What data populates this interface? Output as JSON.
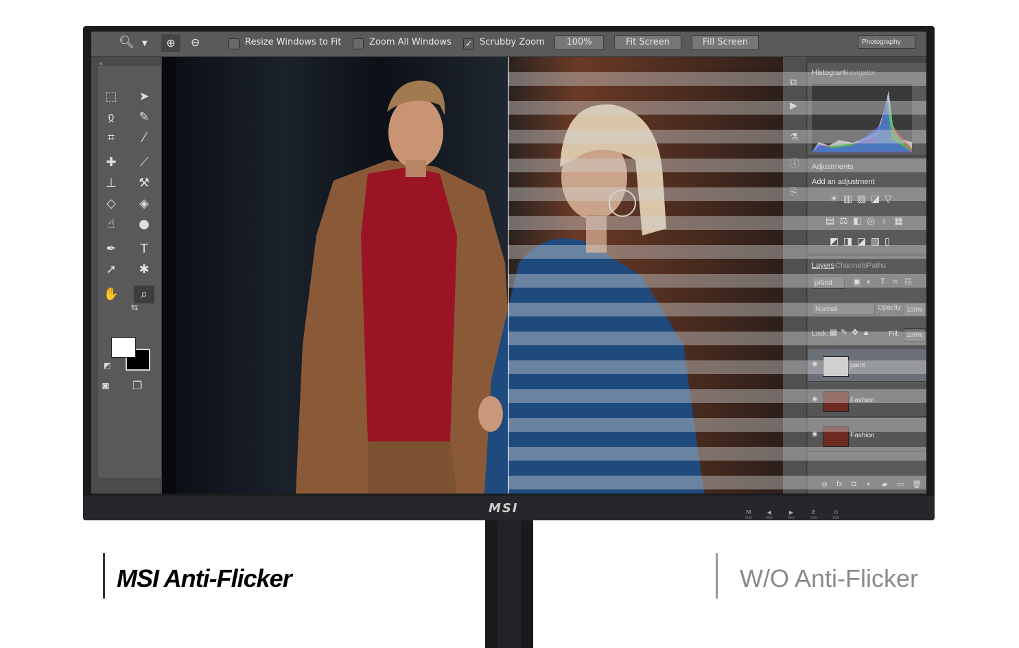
{
  "options_bar": {
    "resize_windows": "Resize Windows to Fit",
    "zoom_all": "Zoom All Windows",
    "scrubby_zoom": "Scrubby Zoom",
    "zoom_level": "100%",
    "fit_screen": "Fit Screen",
    "fill_screen": "Fill Screen",
    "workspace": "Photography"
  },
  "panels": {
    "histogram_tab": "Histogram",
    "navigator_tab": "Navigator",
    "adjustments_title": "Adjustments",
    "add_adjustment": "Add an adjustment",
    "layers_tab": "Layers",
    "channels_tab": "Channels",
    "paths_tab": "Paths",
    "kind": "ρKind",
    "blend_mode": "Normal",
    "opacity_label": "Opacity:",
    "opacity_value": "100%",
    "lock_label": "Lock:",
    "fill_label": "Fill:",
    "fill_value": "100%",
    "layers": [
      {
        "name": "paint",
        "active": true
      },
      {
        "name": "Fashion",
        "active": false
      },
      {
        "name": "Fashion",
        "active": false
      }
    ]
  },
  "monitor": {
    "brand": "MSI",
    "buttons": [
      "M",
      "◀",
      "▶",
      "E",
      "⏻"
    ]
  },
  "captions": {
    "left": "MSI Anti-Flicker",
    "right": "W/O Anti-Flicker"
  },
  "colors": {
    "left_caption": "#000000",
    "right_caption": "#8a8a8a",
    "ps_ui": "#5a5a5a"
  }
}
